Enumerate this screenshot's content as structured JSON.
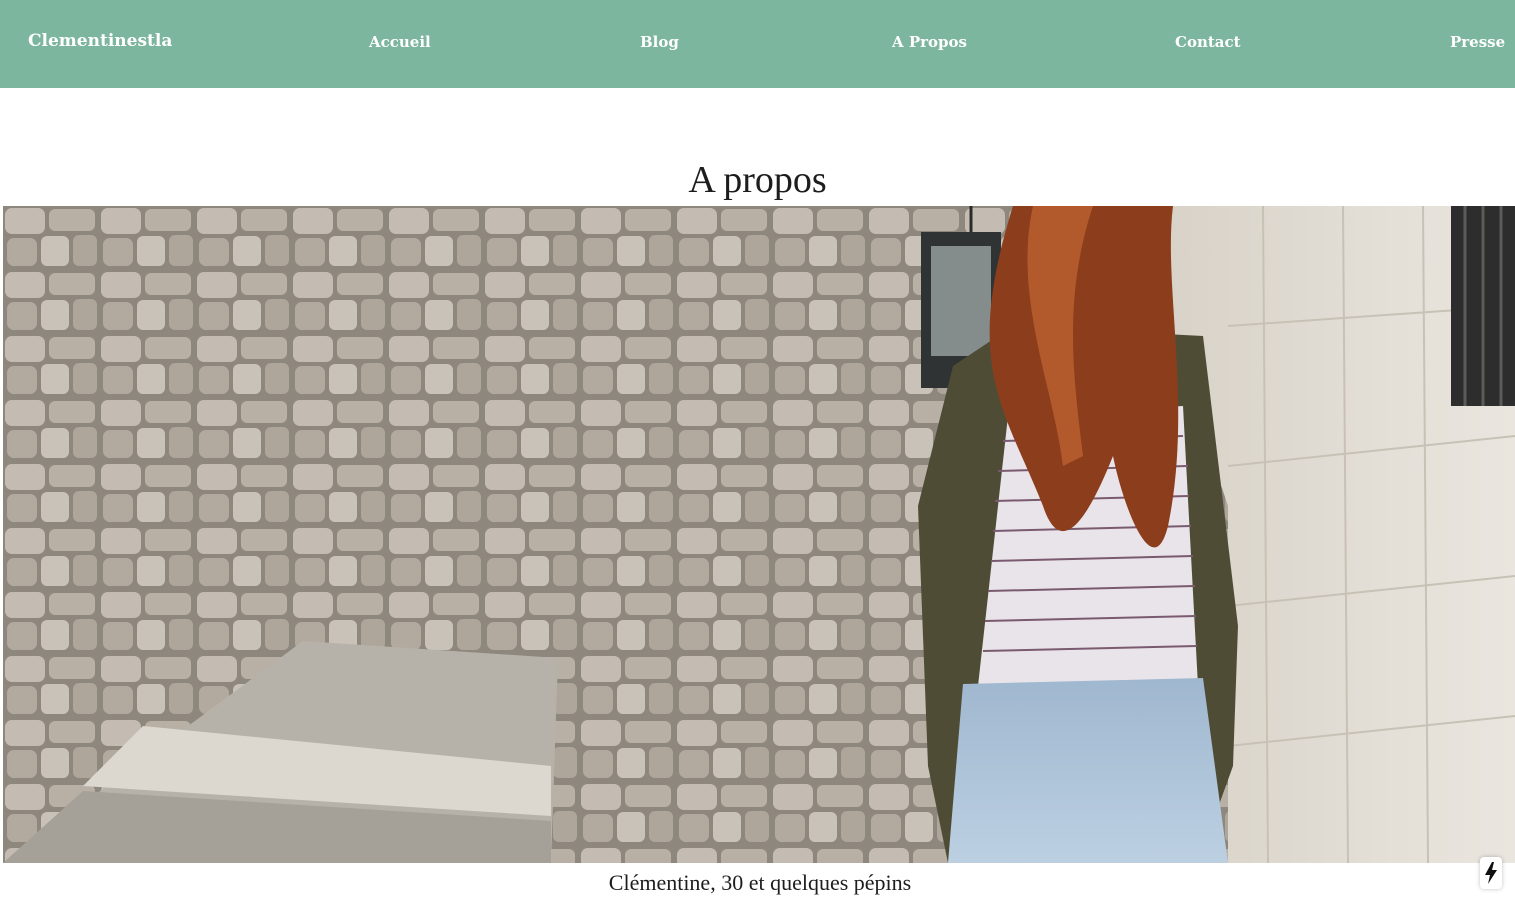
{
  "nav": {
    "brand": "Clementinestla",
    "items": [
      "Accueil",
      "Blog",
      "A Propos",
      "Contact",
      "Presse"
    ]
  },
  "page": {
    "title": "A propos",
    "caption": "Clémentine, 30 et quelques pépins"
  },
  "colors": {
    "nav_bg": "#7db69e",
    "nav_text": "#ffffff",
    "text": "#1d1d1d"
  },
  "icons": {
    "badge": "lightning-bolt-icon"
  }
}
